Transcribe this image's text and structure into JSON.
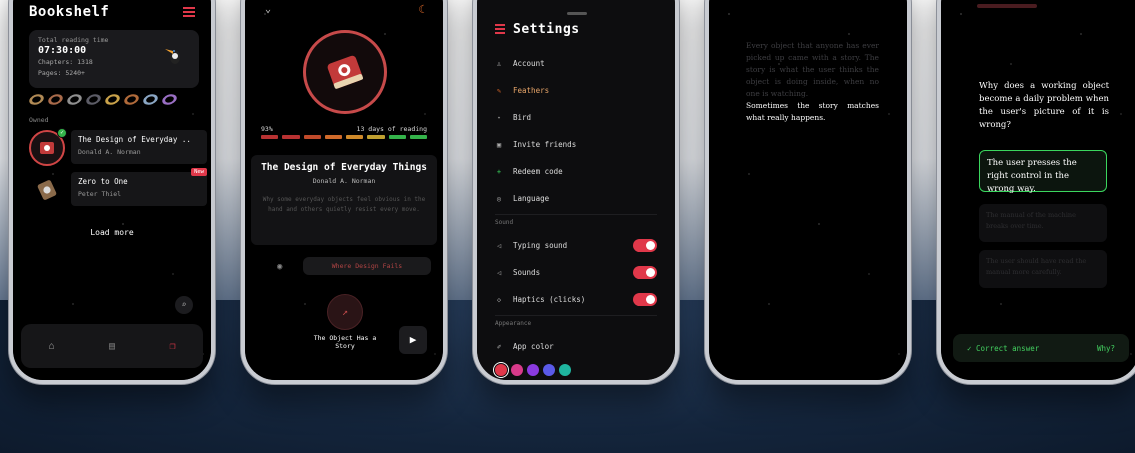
{
  "bookshelf": {
    "title": "Bookshelf",
    "reading_label": "Total reading time",
    "reading_time": "07:30:00",
    "chapters": "Chapters: 1318",
    "pages": "Pages: 5240+",
    "owned_label": "Owned",
    "books": [
      {
        "title": "The Design of Everyday ..",
        "author": "Donald A. Norman"
      },
      {
        "title": "Zero to One",
        "author": "Peter Thiel",
        "badge": "New"
      }
    ],
    "load_more": "Load more",
    "ring_colors": [
      "#b08a55",
      "#a86a4a",
      "#8f8f8f",
      "#5c5c66",
      "#c9a24a",
      "#b06a3a",
      "#8aa6c4",
      "#6f7f98",
      "#9a6fc4"
    ]
  },
  "book_detail": {
    "progress_pct": "93%",
    "progress_text": "13 days of reading",
    "segments": [
      "#b83232",
      "#b83232",
      "#c04a2a",
      "#d06a2a",
      "#d08a2a",
      "#c0a030",
      "#34b34a",
      "#34b34a"
    ],
    "title": "The Design of Everyday Things",
    "author": "Donald A. Norman",
    "description": "Why some everyday objects feel obvious in the hand and others quietly resist every move.",
    "chapter_pill": "Where Design Fails",
    "chapter_title": "The Object Has a Story"
  },
  "settings": {
    "title": "Settings",
    "items": [
      {
        "label": "Account",
        "icon": "user-icon"
      },
      {
        "label": "Feathers",
        "icon": "feather-icon",
        "highlight": true
      },
      {
        "label": "Bird",
        "icon": "bird-icon"
      },
      {
        "label": "Invite friends",
        "icon": "invite-icon"
      },
      {
        "label": "Redeem code",
        "icon": "plus-icon"
      },
      {
        "label": "Language",
        "icon": "globe-icon"
      }
    ],
    "sound_label": "Sound",
    "toggles": [
      {
        "label": "Typing sound",
        "on": true
      },
      {
        "label": "Sounds",
        "on": true
      },
      {
        "label": "Haptics (clicks)",
        "on": true
      }
    ],
    "appearance_label": "Appearance",
    "app_color_label": "App color",
    "colors": [
      "#e0384a",
      "#d83a8a",
      "#8a3ae0",
      "#5a5ae8",
      "#1fb5a0"
    ]
  },
  "story": {
    "dim_lines": "Every object that anyone has ever picked up came with a story. The story is what the user thinks the object is doing inside, when no one is watching.",
    "bright_lines": "Sometimes the story matches what really happens."
  },
  "quiz": {
    "question": "Why does a working object become a daily problem when the user's picture of it is wrong?",
    "answer": "The user presses the right control in the wrong way.",
    "option_2": "The manual of the machine breaks over time.",
    "option_3": "The user should have read the manual more carefully.",
    "result_label": "Correct answer",
    "why_label": "Why?"
  }
}
